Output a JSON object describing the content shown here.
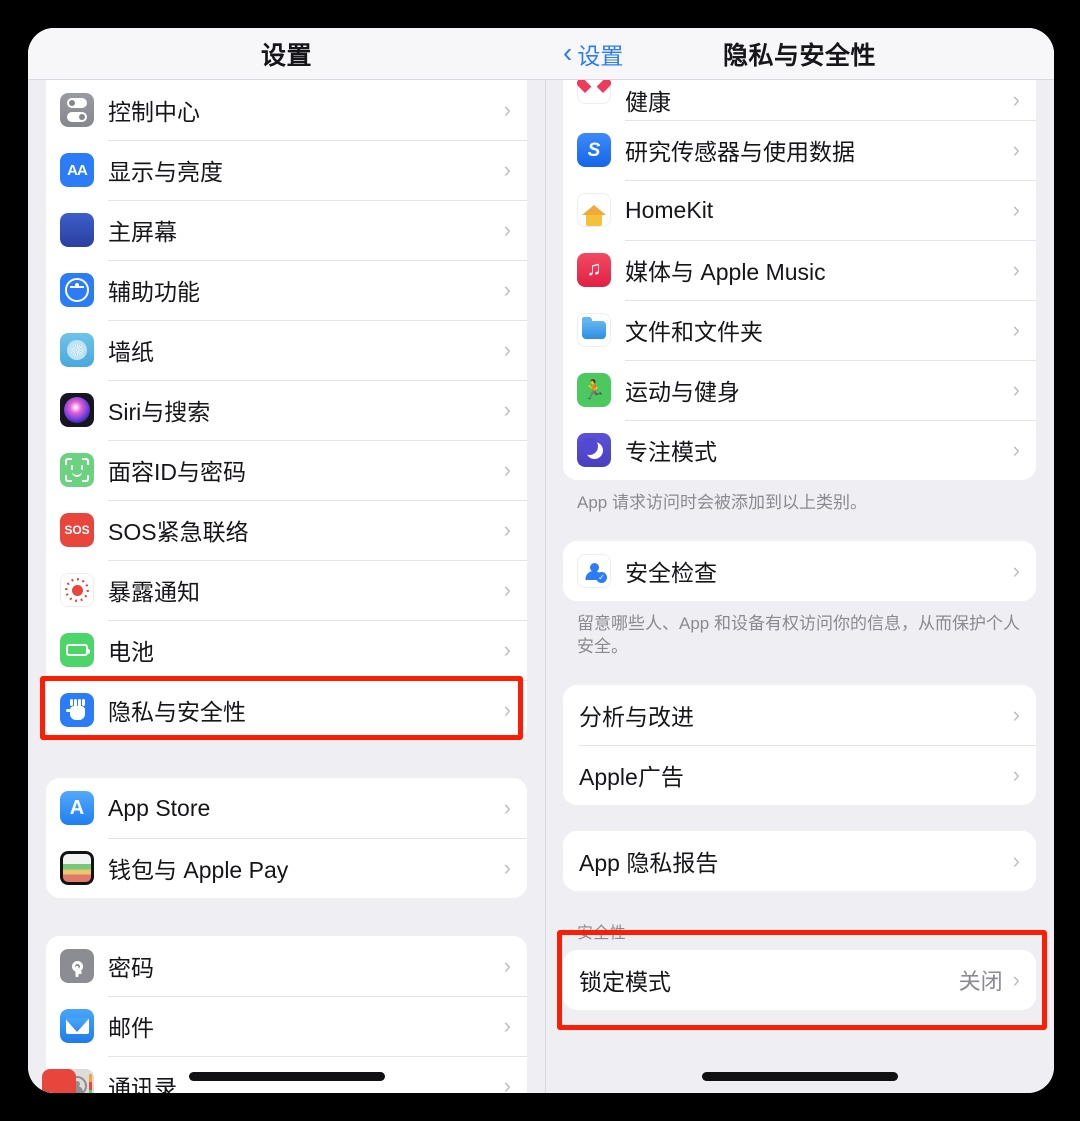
{
  "left_panel": {
    "nav": {
      "title": "设置"
    },
    "groups": [
      {
        "rows": [
          {
            "label": "控制中心",
            "icon": "control-center-icon"
          },
          {
            "label": "显示与亮度",
            "icon": "display-brightness-icon"
          },
          {
            "label": "主屏幕",
            "icon": "home-screen-icon"
          },
          {
            "label": "辅助功能",
            "icon": "accessibility-icon"
          },
          {
            "label": "墙纸",
            "icon": "wallpaper-icon"
          },
          {
            "label": "Siri与搜索",
            "icon": "siri-icon"
          },
          {
            "label": "面容ID与密码",
            "icon": "face-id-icon"
          },
          {
            "label": "SOS紧急联络",
            "icon": "sos-icon"
          },
          {
            "label": "暴露通知",
            "icon": "exposure-notification-icon"
          },
          {
            "label": "电池",
            "icon": "battery-icon"
          },
          {
            "label": "隐私与安全性",
            "icon": "privacy-hand-icon",
            "highlighted": true
          }
        ]
      },
      {
        "rows": [
          {
            "label": "App Store",
            "icon": "app-store-icon"
          },
          {
            "label": "钱包与 Apple Pay",
            "icon": "wallet-icon"
          }
        ]
      },
      {
        "rows": [
          {
            "label": "密码",
            "icon": "password-key-icon"
          },
          {
            "label": "邮件",
            "icon": "mail-icon"
          },
          {
            "label": "通讯录",
            "icon": "contacts-icon"
          }
        ]
      }
    ]
  },
  "right_panel": {
    "nav": {
      "back_label": "设置",
      "title": "隐私与安全性"
    },
    "groups": [
      {
        "rows": [
          {
            "label": "健康",
            "icon": "health-icon"
          },
          {
            "label": "研究传感器与使用数据",
            "icon": "research-sensor-icon"
          },
          {
            "label": "HomeKit",
            "icon": "homekit-icon"
          },
          {
            "label": "媒体与 Apple Music",
            "icon": "apple-music-icon"
          },
          {
            "label": "文件和文件夹",
            "icon": "files-icon"
          },
          {
            "label": "运动与健身",
            "icon": "fitness-icon"
          },
          {
            "label": "专注模式",
            "icon": "focus-icon"
          }
        ],
        "footnote": "App 请求访问时会被添加到以上类别。"
      },
      {
        "rows": [
          {
            "label": "安全检查",
            "icon": "safety-check-icon"
          }
        ],
        "footnote": "留意哪些人、App 和设备有权访问你的信息，从而保护个人安全。"
      },
      {
        "rows": [
          {
            "label": "分析与改进"
          },
          {
            "label": "Apple广告"
          }
        ]
      },
      {
        "rows": [
          {
            "label": "App 隐私报告"
          }
        ]
      },
      {
        "header": "安全性",
        "highlighted": true,
        "rows": [
          {
            "label": "锁定模式",
            "value": "关闭"
          }
        ]
      }
    ]
  },
  "annotations": {
    "highlight_color": "#fb1e05",
    "privacy_row_label": "隐私与安全性",
    "lockdown_section_label": "安全性",
    "lockdown_row_label": "锁定模式",
    "lockdown_row_value": "关闭"
  },
  "chrome": {
    "chevron_glyph": "›",
    "back_chevron_glyph": "‹"
  }
}
